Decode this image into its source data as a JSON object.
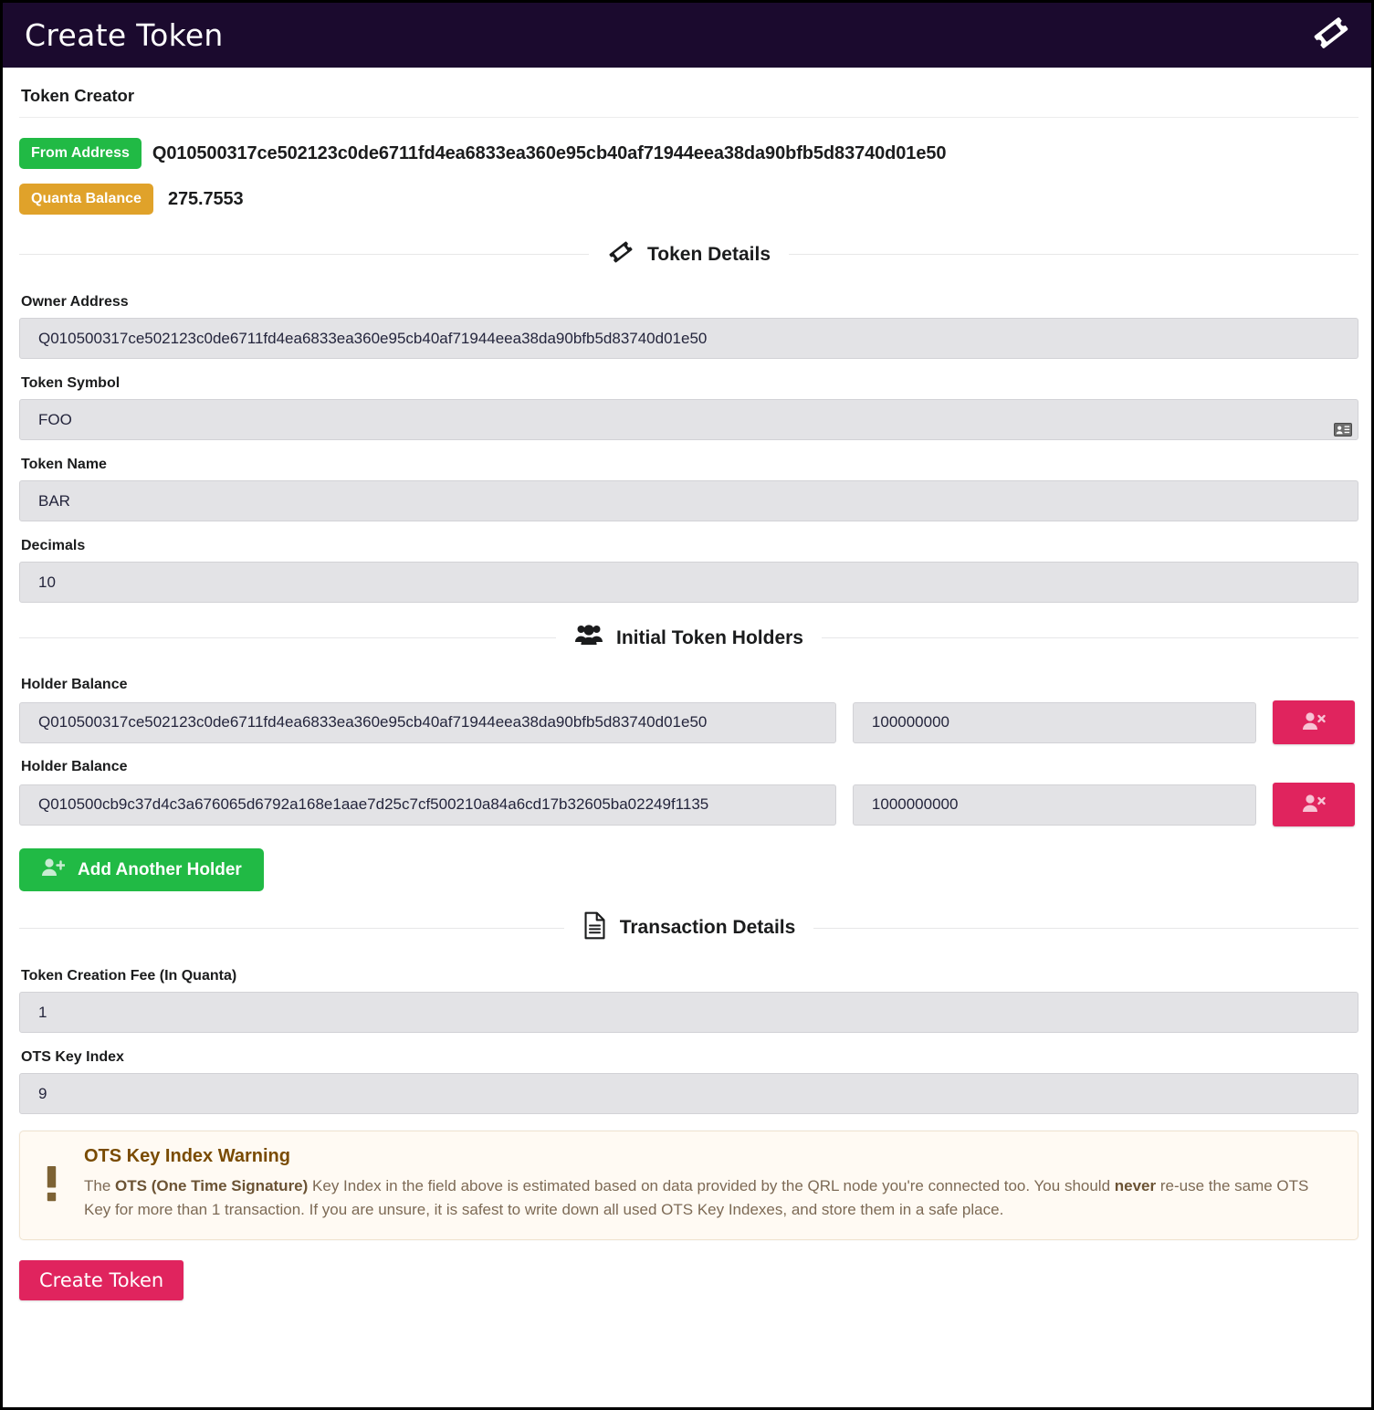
{
  "topbar": {
    "title": "Create Token",
    "logo_icon": "ticket-icon"
  },
  "creator": {
    "heading": "Token Creator",
    "from_address_label": "From Address",
    "from_address_value": "Q010500317ce502123c0de6711fd4ea6833ea360e95cb40af71944eea38da90bfb5d83740d01e50",
    "quanta_balance_label": "Quanta Balance",
    "quanta_balance_value": "275.7553",
    "from_address_badge_color": "#21ba45",
    "quanta_balance_badge_color": "#e0a22a"
  },
  "token_details": {
    "section_heading": "Token Details",
    "section_icon": "ticket-icon",
    "owner_address_label": "Owner Address",
    "owner_address_value": "Q010500317ce502123c0de6711fd4ea6833ea360e95cb40af71944eea38da90bfb5d83740d01e50",
    "token_symbol_label": "Token Symbol",
    "token_symbol_value": "FOO",
    "token_symbol_autofill_icon": "contact-card-icon",
    "token_name_label": "Token Name",
    "token_name_value": "BAR",
    "decimals_label": "Decimals",
    "decimals_value": "10"
  },
  "initial_token_holders": {
    "section_heading": "Initial Token Holders",
    "section_icon": "users-icon",
    "holders": [
      {
        "label": "Holder Balance",
        "address": "Q010500317ce502123c0de6711fd4ea6833ea360e95cb40af71944eea38da90bfb5d83740d01e50",
        "balance": "100000000",
        "remove_icon": "user-times-icon"
      },
      {
        "label": "Holder Balance",
        "address": "Q010500cb9c37d4c3a676065d6792a168e1aae7d25c7cf500210a84a6cd17b32605ba02249f1135",
        "balance": "1000000000",
        "remove_icon": "user-times-icon"
      }
    ],
    "add_holder_label": "Add Another Holder",
    "add_holder_icon": "user-plus-icon",
    "add_holder_color": "#21ba45",
    "remove_holder_color": "#e0245e"
  },
  "transaction_details": {
    "section_heading": "Transaction Details",
    "section_icon": "file-document-icon",
    "fee_label": "Token Creation Fee (In Quanta)",
    "fee_value": "1",
    "ots_label": "OTS Key Index",
    "ots_value": "9"
  },
  "warning": {
    "icon": "exclamation-icon",
    "title": "OTS Key Index Warning",
    "text_part1": "The ",
    "text_bold1": "OTS (One Time Signature)",
    "text_part2": " Key Index in the field above is estimated based on data provided by the QRL node you're connected too. You should ",
    "text_bold2": "never",
    "text_part3": " re-use the same OTS Key for more than 1 transaction. If you are unsure, it is safest to write down all used OTS Key Indexes, and store them in a safe place."
  },
  "footer": {
    "create_token_label": "Create Token",
    "create_token_color": "#e0245e"
  }
}
